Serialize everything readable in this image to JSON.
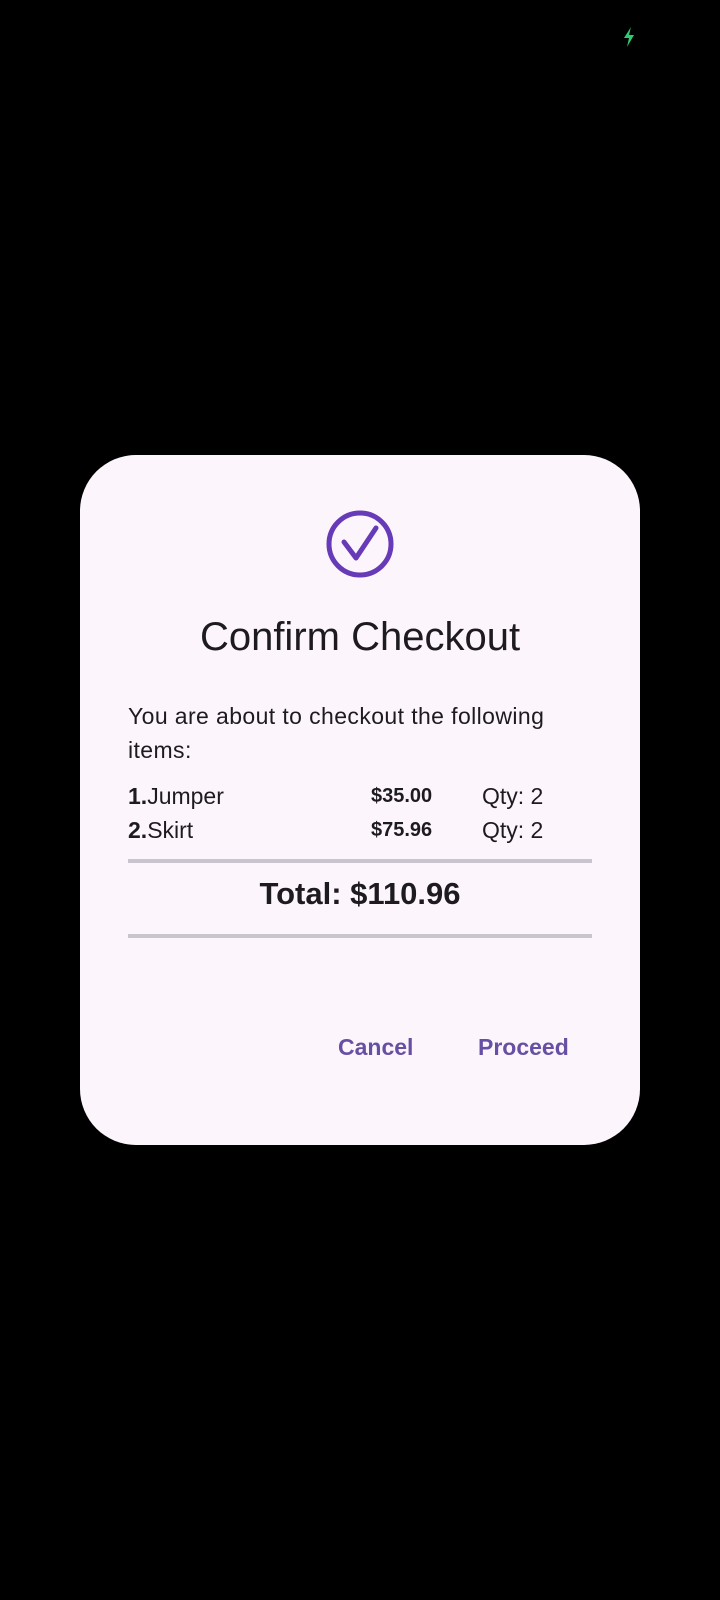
{
  "colors": {
    "background": "#000000",
    "dialog_surface": "#FCF6FC",
    "primary": "#6750A4",
    "on_surface": "#1D1B20",
    "divider": "#CAC4CF",
    "charging": "#2ECC71"
  },
  "status_bar": {
    "icon": "battery-charging-icon"
  },
  "dialog": {
    "icon": "check-circle-icon",
    "title": "Confirm Checkout",
    "message": "You are about to checkout the following items:",
    "items": [
      {
        "number": "1.",
        "name": "Jumper",
        "price": "$35.00",
        "qty": "Qty: 2"
      },
      {
        "number": "2.",
        "name": "Skirt",
        "price": "$75.96",
        "qty": "Qty: 2"
      }
    ],
    "total": "Total: $110.96",
    "cancel_label": "Cancel",
    "proceed_label": "Proceed"
  }
}
